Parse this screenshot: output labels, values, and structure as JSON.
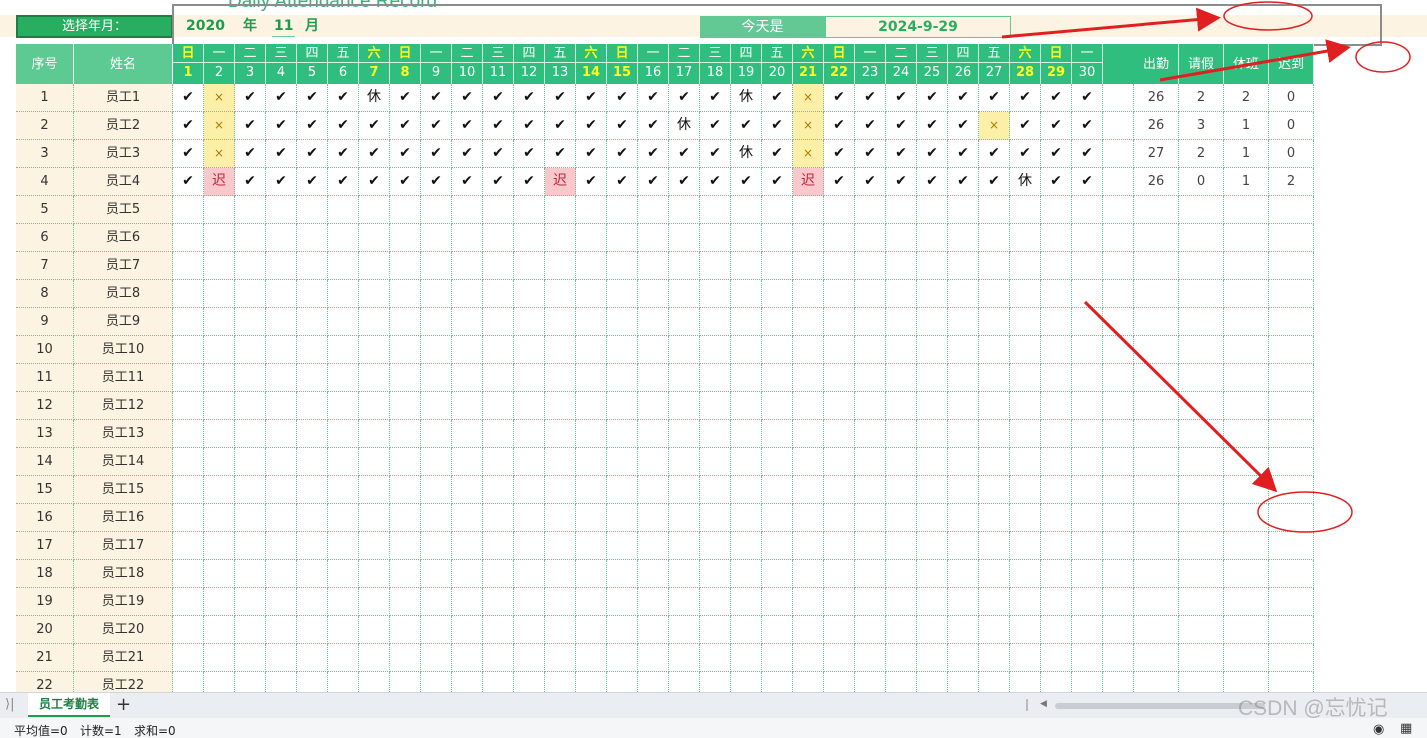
{
  "title": "Daily Attendance Record",
  "select_label": "选择年月：",
  "year_value": "2020",
  "year_unit": "年",
  "month_value": "11",
  "month_unit": "月",
  "today_label": "今天是",
  "today_value": "2024-9-29",
  "columns": {
    "index": "序号",
    "name": "姓名",
    "summary": [
      "出勤",
      "请假",
      "休班",
      "迟到"
    ]
  },
  "days": [
    {
      "wk": "日",
      "d": "1",
      "weekend": true
    },
    {
      "wk": "一",
      "d": "2",
      "weekend": false
    },
    {
      "wk": "二",
      "d": "3",
      "weekend": false
    },
    {
      "wk": "三",
      "d": "4",
      "weekend": false
    },
    {
      "wk": "四",
      "d": "5",
      "weekend": false
    },
    {
      "wk": "五",
      "d": "6",
      "weekend": false
    },
    {
      "wk": "六",
      "d": "7",
      "weekend": true
    },
    {
      "wk": "日",
      "d": "8",
      "weekend": true
    },
    {
      "wk": "一",
      "d": "9",
      "weekend": false
    },
    {
      "wk": "二",
      "d": "10",
      "weekend": false
    },
    {
      "wk": "三",
      "d": "11",
      "weekend": false
    },
    {
      "wk": "四",
      "d": "12",
      "weekend": false
    },
    {
      "wk": "五",
      "d": "13",
      "weekend": false
    },
    {
      "wk": "六",
      "d": "14",
      "weekend": true
    },
    {
      "wk": "日",
      "d": "15",
      "weekend": true
    },
    {
      "wk": "一",
      "d": "16",
      "weekend": false
    },
    {
      "wk": "二",
      "d": "17",
      "weekend": false
    },
    {
      "wk": "三",
      "d": "18",
      "weekend": false
    },
    {
      "wk": "四",
      "d": "19",
      "weekend": false
    },
    {
      "wk": "五",
      "d": "20",
      "weekend": false
    },
    {
      "wk": "六",
      "d": "21",
      "weekend": true
    },
    {
      "wk": "日",
      "d": "22",
      "weekend": true
    },
    {
      "wk": "一",
      "d": "23",
      "weekend": false
    },
    {
      "wk": "二",
      "d": "24",
      "weekend": false
    },
    {
      "wk": "三",
      "d": "25",
      "weekend": false
    },
    {
      "wk": "四",
      "d": "26",
      "weekend": false
    },
    {
      "wk": "五",
      "d": "27",
      "weekend": false
    },
    {
      "wk": "六",
      "d": "28",
      "weekend": true
    },
    {
      "wk": "日",
      "d": "29",
      "weekend": true
    },
    {
      "wk": "一",
      "d": "30",
      "weekend": false
    }
  ],
  "employees": [
    {
      "idx": "1",
      "name": "员工1",
      "marks": [
        "✔",
        "×",
        "✔",
        "✔",
        "✔",
        "✔",
        "休",
        "✔",
        "✔",
        "✔",
        "✔",
        "✔",
        "✔",
        "✔",
        "✔",
        "✔",
        "✔",
        "✔",
        "休",
        "✔",
        "×",
        "✔",
        "✔",
        "✔",
        "✔",
        "✔",
        "✔",
        "✔",
        "✔",
        "✔"
      ],
      "summary": [
        "26",
        "2",
        "2",
        "0"
      ]
    },
    {
      "idx": "2",
      "name": "员工2",
      "marks": [
        "✔",
        "×",
        "✔",
        "✔",
        "✔",
        "✔",
        "✔",
        "✔",
        "✔",
        "✔",
        "✔",
        "✔",
        "✔",
        "✔",
        "✔",
        "✔",
        "休",
        "✔",
        "✔",
        "✔",
        "×",
        "✔",
        "✔",
        "✔",
        "✔",
        "✔",
        "×",
        "✔",
        "✔",
        "✔"
      ],
      "summary": [
        "26",
        "3",
        "1",
        "0"
      ]
    },
    {
      "idx": "3",
      "name": "员工3",
      "marks": [
        "✔",
        "×",
        "✔",
        "✔",
        "✔",
        "✔",
        "✔",
        "✔",
        "✔",
        "✔",
        "✔",
        "✔",
        "✔",
        "✔",
        "✔",
        "✔",
        "✔",
        "✔",
        "休",
        "✔",
        "×",
        "✔",
        "✔",
        "✔",
        "✔",
        "✔",
        "✔",
        "✔",
        "✔",
        "✔"
      ],
      "summary": [
        "27",
        "2",
        "1",
        "0"
      ]
    },
    {
      "idx": "4",
      "name": "员工4",
      "marks": [
        "✔",
        "迟",
        "✔",
        "✔",
        "✔",
        "✔",
        "✔",
        "✔",
        "✔",
        "✔",
        "✔",
        "✔",
        "迟",
        "✔",
        "✔",
        "✔",
        "✔",
        "✔",
        "✔",
        "✔",
        "迟",
        "✔",
        "✔",
        "✔",
        "✔",
        "✔",
        "✔",
        "休",
        "✔",
        "✔"
      ],
      "summary": [
        "26",
        "0",
        "1",
        "2"
      ]
    },
    {
      "idx": "5",
      "name": "员工5"
    },
    {
      "idx": "6",
      "name": "员工6"
    },
    {
      "idx": "7",
      "name": "员工7"
    },
    {
      "idx": "8",
      "name": "员工8"
    },
    {
      "idx": "9",
      "name": "员工9"
    },
    {
      "idx": "10",
      "name": "员工10"
    },
    {
      "idx": "11",
      "name": "员工11"
    },
    {
      "idx": "12",
      "name": "员工12"
    },
    {
      "idx": "13",
      "name": "员工13"
    },
    {
      "idx": "14",
      "name": "员工14"
    },
    {
      "idx": "15",
      "name": "员工15"
    },
    {
      "idx": "16",
      "name": "员工16"
    },
    {
      "idx": "17",
      "name": "员工17"
    },
    {
      "idx": "18",
      "name": "员工18"
    },
    {
      "idx": "19",
      "name": "员工19"
    },
    {
      "idx": "20",
      "name": "员工20"
    },
    {
      "idx": "21",
      "name": "员工21"
    },
    {
      "idx": "22",
      "name": "员工22"
    }
  ],
  "sheet_tab": "员工考勤表",
  "add_sheet": "+",
  "status": {
    "average": "平均值=0",
    "count": "计数=1",
    "sum": "求和=0"
  },
  "watermark": "CSDN @忘忧记",
  "colors": {
    "header_green": "#2fbe7d",
    "label_green": "#27ae60",
    "leave_yellow": "#fcefa8",
    "late_pink": "#f9c8cd",
    "row_cream": "#fdf3e2",
    "annotation_red": "#e02020"
  },
  "icons": {
    "check": "check-icon",
    "leave": "cross-icon",
    "add_sheet": "plus-icon",
    "view": "eye-icon",
    "layout": "grid-icon"
  }
}
